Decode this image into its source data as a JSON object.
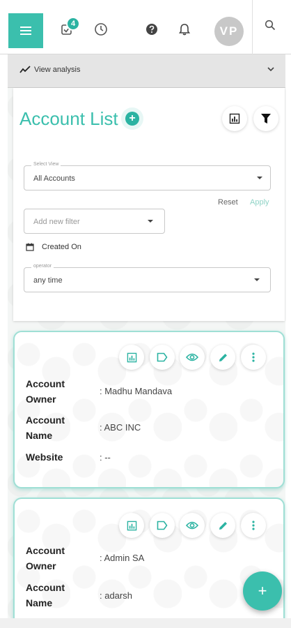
{
  "header": {
    "task_badge_count": "4",
    "avatar_initials": "VP"
  },
  "analysis_bar": {
    "label": "View analysis"
  },
  "account_list": {
    "title": "Account List",
    "select_view": {
      "label": "Select View",
      "value": "All Accounts"
    },
    "reset_label": "Reset",
    "apply_label": "Apply",
    "filter": {
      "placeholder": "Add new filter"
    },
    "created_on_label": "Created On",
    "operator": {
      "label": "operator",
      "value": "any time"
    }
  },
  "accounts": [
    {
      "owner_label": "Account Owner",
      "owner_value": ": Madhu Mandava",
      "name_label": "Account Name",
      "name_value": ": ABC INC",
      "website_label": "Website",
      "website_value": ": --"
    },
    {
      "owner_label": "Account Owner",
      "owner_value": ": Admin SA",
      "name_label": "Account Name",
      "name_value": ": adarsh"
    }
  ],
  "fab_label": "+",
  "colors": {
    "accent": "#3bbfad",
    "badge": "#2bb3a2",
    "card_border": "#9fdfd5"
  },
  "icons": [
    "menu-icon",
    "tasks-icon",
    "clock-icon",
    "help-icon",
    "bell-icon",
    "search-icon",
    "trend-icon",
    "chevron-down-icon",
    "plus-icon",
    "report-icon",
    "filter-icon",
    "calendar-icon",
    "label-icon",
    "eye-icon",
    "edit-icon",
    "more-icon"
  ]
}
